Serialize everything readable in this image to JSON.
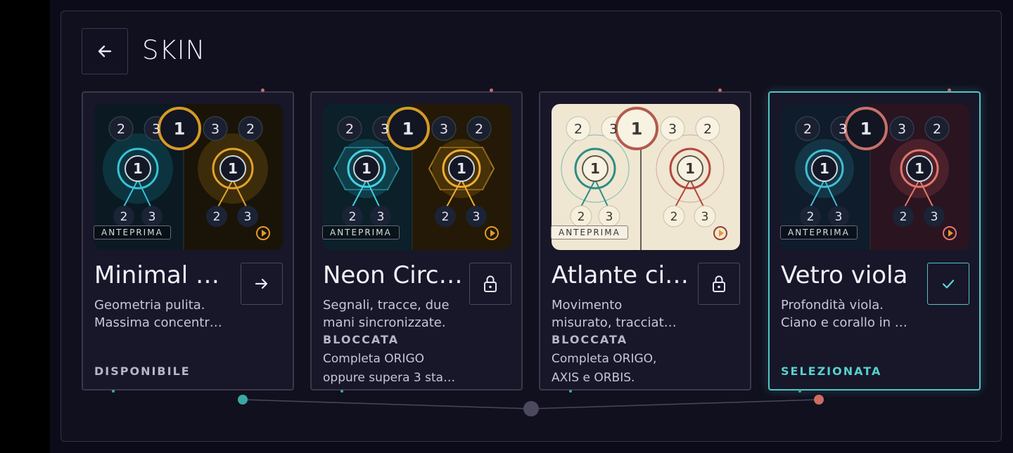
{
  "header": {
    "title": "SKIN",
    "back_icon": "arrow-left-icon"
  },
  "colors": {
    "selected": "#4fc6c6",
    "teal": "#36b6c8",
    "amber": "#e39a2c",
    "coral": "#d06a62"
  },
  "skins": [
    {
      "name": "Minimal D…",
      "desc": [
        "Geometria pulita.",
        "Massima concentr…"
      ],
      "preview_badge": "ANTEPRIMA",
      "action_icon": "arrow-right-icon",
      "status": "DISPONIBILE",
      "locked_label": "",
      "requirement": []
    },
    {
      "name": "Neon Circ…",
      "desc": [
        "Segnali, tracce, due",
        "mani sincronizzate."
      ],
      "preview_badge": "ANTEPRIMA",
      "action_icon": "lock-icon",
      "status": "",
      "locked_label": "BLOCCATA",
      "requirement": [
        "Completa ORIGO",
        "oppure supera 3 sta…"
      ]
    },
    {
      "name": "Atlante ci…",
      "desc": [
        "Movimento",
        "misurato, tracciat…"
      ],
      "preview_badge": "ANTEPRIMA",
      "action_icon": "lock-icon",
      "status": "",
      "locked_label": "BLOCCATA",
      "requirement": [
        "Completa ORIGO,",
        "AXIS e ORBIS."
      ]
    },
    {
      "name": "Vetro viola",
      "desc": [
        "Profondità viola.",
        "Ciano e corallo in …"
      ],
      "preview_badge": "ANTEPRIMA",
      "action_icon": "check-icon",
      "status": "SELEZIONATA",
      "locked_label": "",
      "requirement": []
    }
  ],
  "preview_numbers": {
    "top": [
      "2",
      "3",
      "1",
      "3",
      "2"
    ],
    "center": "1",
    "bottom": [
      "2",
      "3"
    ]
  }
}
